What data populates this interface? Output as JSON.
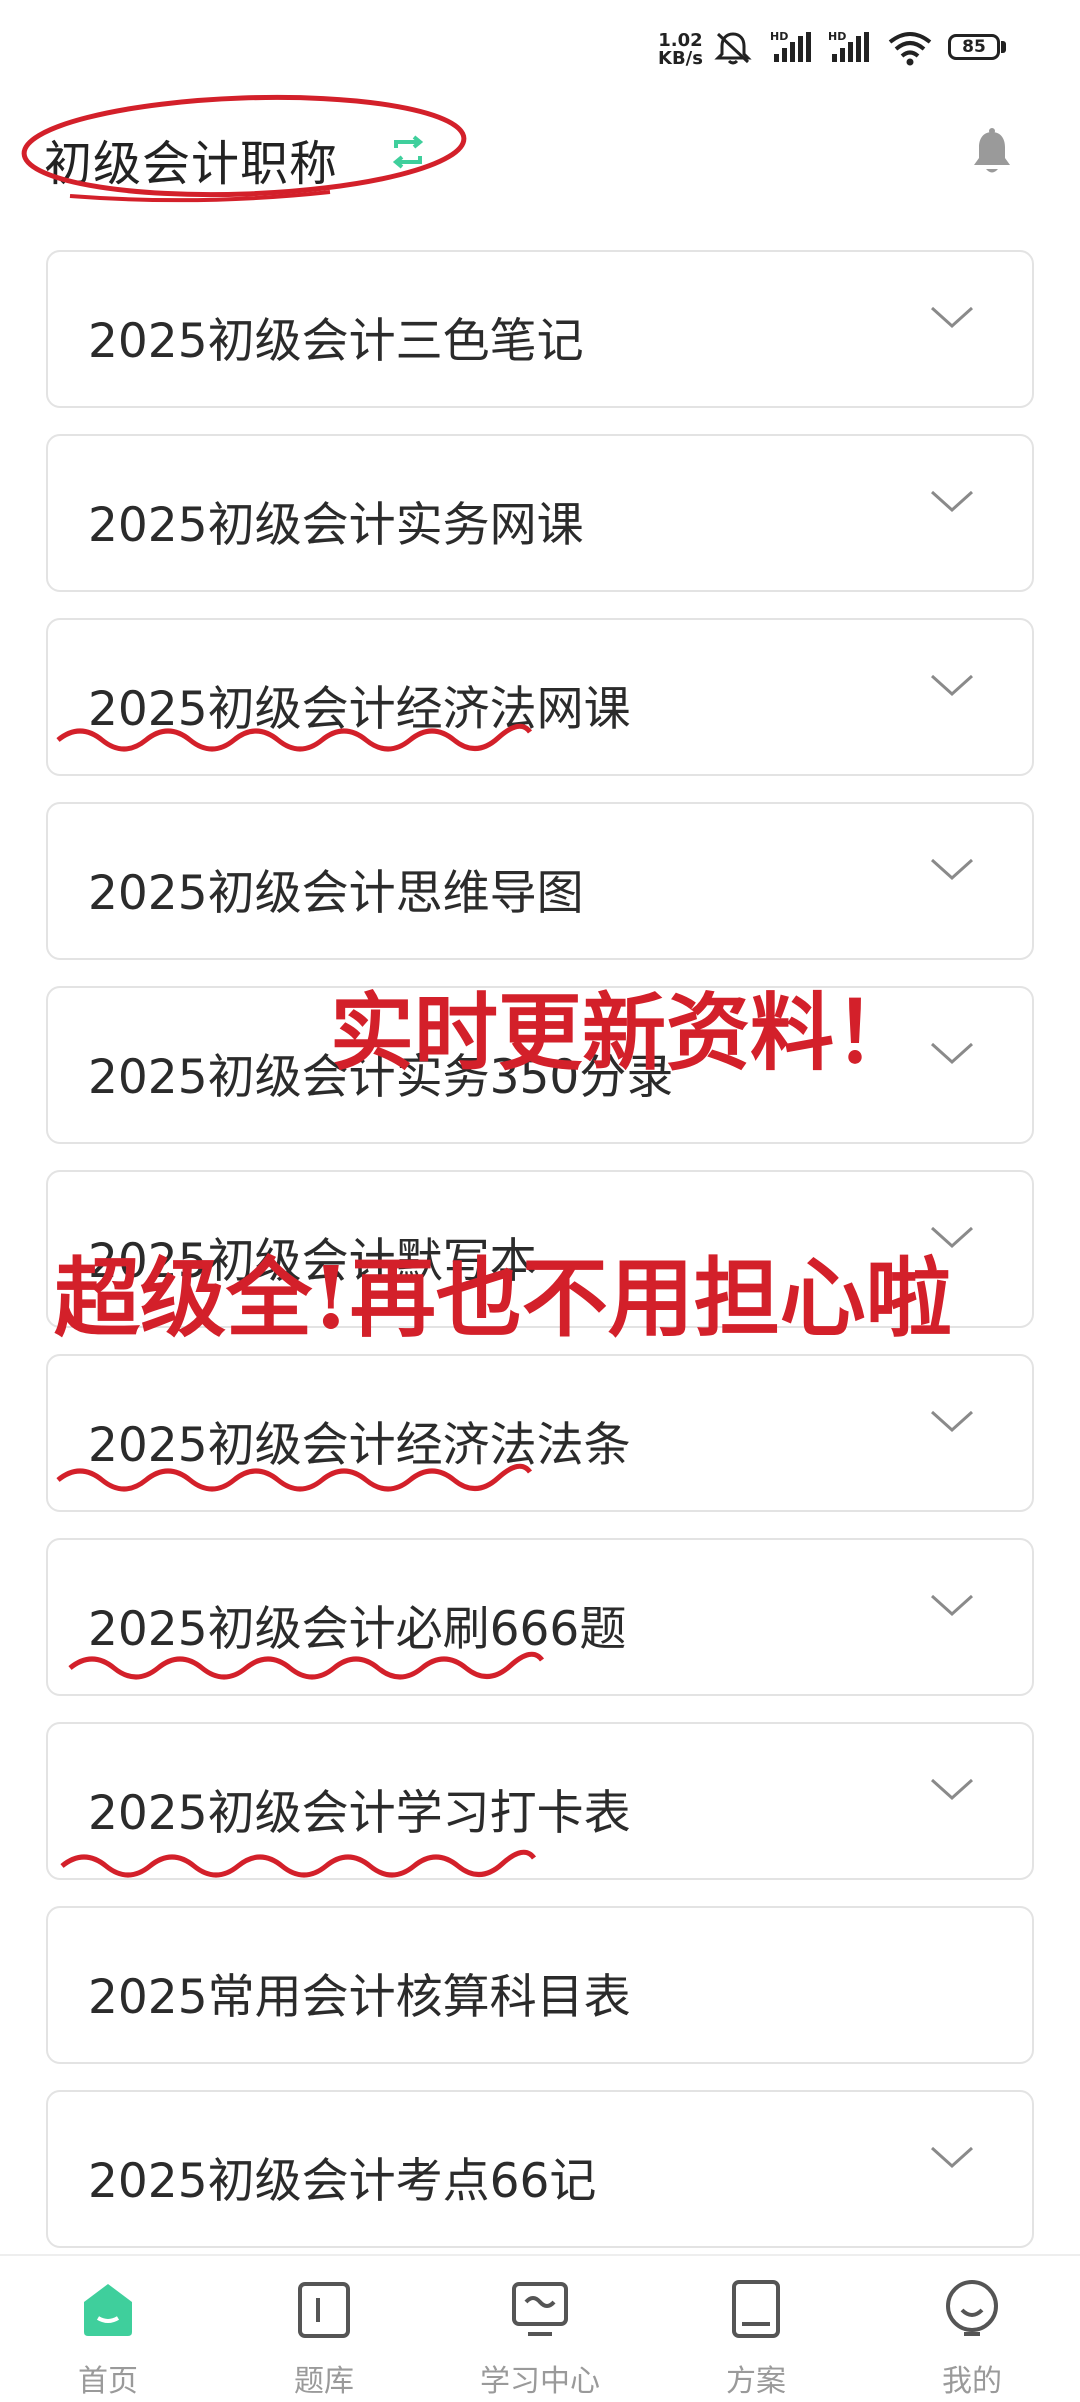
{
  "status_bar": {
    "speed_value": "1.02",
    "speed_unit": "KB/s",
    "battery": "85",
    "icons": [
      "mute-icon",
      "signal-hd-icon",
      "signal-hd-icon",
      "wifi-icon",
      "battery-icon"
    ]
  },
  "header": {
    "title": "初级会计职称",
    "icons": [
      "switch-icon",
      "bell-icon"
    ]
  },
  "list": {
    "items": [
      {
        "label": "2025初级会计三色笔记",
        "expandable": true
      },
      {
        "label": "2025初级会计实务网课",
        "expandable": true
      },
      {
        "label": "2025初级会计经济法网课",
        "expandable": true
      },
      {
        "label": "2025初级会计思维导图",
        "expandable": true
      },
      {
        "label": "2025初级会计实务350分录",
        "expandable": true
      },
      {
        "label": "2025初级会计默写本",
        "expandable": true
      },
      {
        "label": "2025初级会计经济法法条",
        "expandable": true
      },
      {
        "label": "2025初级会计必刷666题",
        "expandable": true
      },
      {
        "label": "2025初级会计学习打卡表",
        "expandable": true
      },
      {
        "label": "2025常用会计核算科目表",
        "expandable": false
      },
      {
        "label": "2025初级会计考点66记",
        "expandable": true
      }
    ]
  },
  "annotations": {
    "line1": "实时更新资料！",
    "line2": "超级全!再也不用担心啦",
    "color": "#d3202a"
  },
  "bottom_nav": {
    "items": [
      {
        "label": "首页",
        "icon": "home-icon",
        "active": true
      },
      {
        "label": "题库",
        "icon": "question-bank-icon",
        "active": false
      },
      {
        "label": "学习中心",
        "icon": "monitor-icon",
        "active": false
      },
      {
        "label": "方案",
        "icon": "book-icon",
        "active": false
      },
      {
        "label": "我的",
        "icon": "profile-icon",
        "active": false
      }
    ]
  },
  "colors": {
    "accent_green": "#3fcf9c",
    "text": "#2b2b2b",
    "border": "#e3e3e3",
    "nav_inactive": "#9a9a9a",
    "annotation_red": "#d3202a"
  }
}
